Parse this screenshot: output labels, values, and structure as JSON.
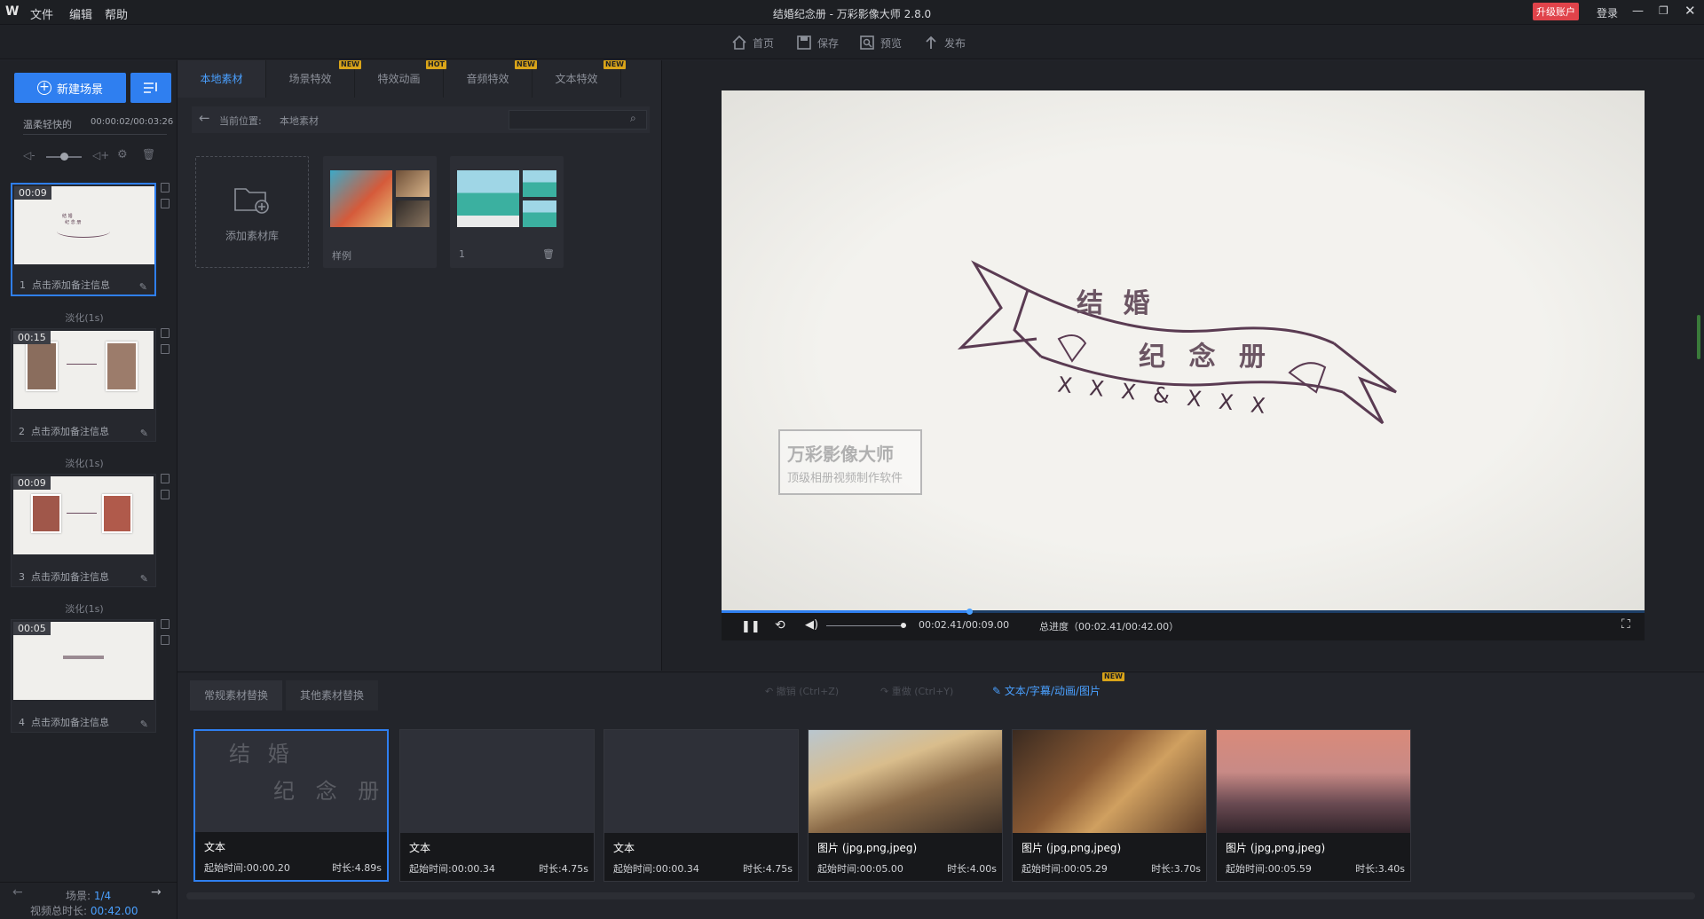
{
  "window": {
    "title": "结婚纪念册 - 万彩影像大师 2.8.0",
    "logo": "W",
    "upgrade": "升级账户",
    "login": "登录"
  },
  "menu": [
    "文件",
    "编辑",
    "帮助"
  ],
  "toolbar": {
    "home": "首页",
    "save": "保存",
    "preview": "预览",
    "publish": "发布"
  },
  "left": {
    "new_scene": "新建场景",
    "music_name": "温柔轻快的",
    "music_time": "00:00:02/00:03:26",
    "scenes": [
      {
        "num": "1",
        "time": "00:09",
        "note": "点击添加备注信息"
      },
      {
        "num": "2",
        "time": "00:15",
        "note": "点击添加备注信息"
      },
      {
        "num": "3",
        "time": "00:09",
        "note": "点击添加备注信息"
      },
      {
        "num": "4",
        "time": "00:05",
        "note": "点击添加备注信息"
      }
    ],
    "transitions": [
      "淡化(1s)",
      "淡化(1s)",
      "淡化(1s)"
    ],
    "scene_counter_label": "场景:",
    "scene_counter": "1/4",
    "total_label": "视频总时长:",
    "total": "00:42.00"
  },
  "library": {
    "tabs": [
      "本地素材",
      "场景特效",
      "特效动画",
      "音频特效",
      "文本特效"
    ],
    "tags": [
      "NEW",
      "HOT",
      "NEW",
      "NEW"
    ],
    "location_label": "当前位置:",
    "location": "本地素材",
    "add_library": "添加素材库",
    "cards": [
      "样例",
      "1"
    ]
  },
  "player": {
    "time": "00:02.41/00:09.00",
    "total_progress": "总进度（00:02.41/00:42.00）",
    "progress": 0.268
  },
  "canvas": {
    "line1": "结 婚",
    "line2": "纪 念 册",
    "line3": "X X X & X X X",
    "watermark_title": "万彩影像大师",
    "watermark_sub": "顶级相册视频制作软件"
  },
  "bottom": {
    "tabs": [
      "常规素材替换",
      "其他素材替换"
    ],
    "undo": "撤销 (Ctrl+Z)",
    "redo": "重做 (Ctrl+Y)",
    "edit_text": "文本/字幕/动画/图片",
    "edit_tag": "NEW",
    "cards": [
      {
        "type": "文本",
        "start": "起始时间:00:00.20",
        "dur": "时长:4.89s",
        "text1": "结 婚",
        "text2": "纪 念 册"
      },
      {
        "type": "文本",
        "start": "起始时间:00:00.34",
        "dur": "时长:4.75s"
      },
      {
        "type": "文本",
        "start": "起始时间:00:00.34",
        "dur": "时长:4.75s"
      },
      {
        "type": "图片 (jpg,png,jpeg)",
        "start": "起始时间:00:05.00",
        "dur": "时长:4.00s"
      },
      {
        "type": "图片 (jpg,png,jpeg)",
        "start": "起始时间:00:05.29",
        "dur": "时长:3.70s"
      },
      {
        "type": "图片 (jpg,png,jpeg)",
        "start": "起始时间:00:05.59",
        "dur": "时长:3.40s"
      }
    ]
  },
  "colors": {
    "accent": "#2f7ff0",
    "tag": "#d9a419",
    "upgrade": "#e0434a"
  }
}
